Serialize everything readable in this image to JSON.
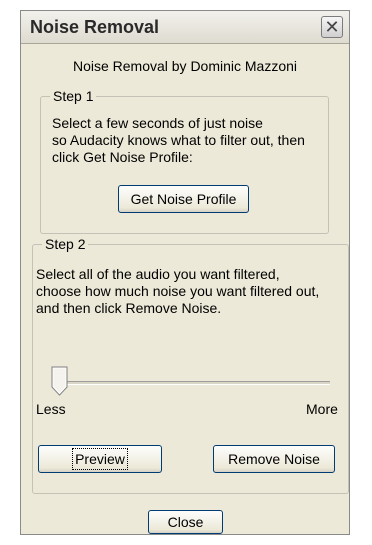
{
  "window": {
    "title": "Noise Removal",
    "close_glyph": "✕"
  },
  "byline": "Noise Removal by Dominic Mazzoni",
  "step1": {
    "legend": "Step 1",
    "lines": [
      "Select a few seconds of just noise",
      "so Audacity knows what to filter out, then",
      "click Get Noise Profile:"
    ],
    "button": "Get Noise Profile"
  },
  "step2": {
    "legend": "Step 2",
    "lines": [
      "Select all of the audio you want filtered,",
      "choose how much noise you want filtered out,",
      "and then click Remove Noise."
    ],
    "slider": {
      "level": 0.0,
      "min_label": "Less",
      "max_label": "More"
    },
    "preview_button": "Preview",
    "remove_button": "Remove Noise"
  },
  "close_button": "Close"
}
